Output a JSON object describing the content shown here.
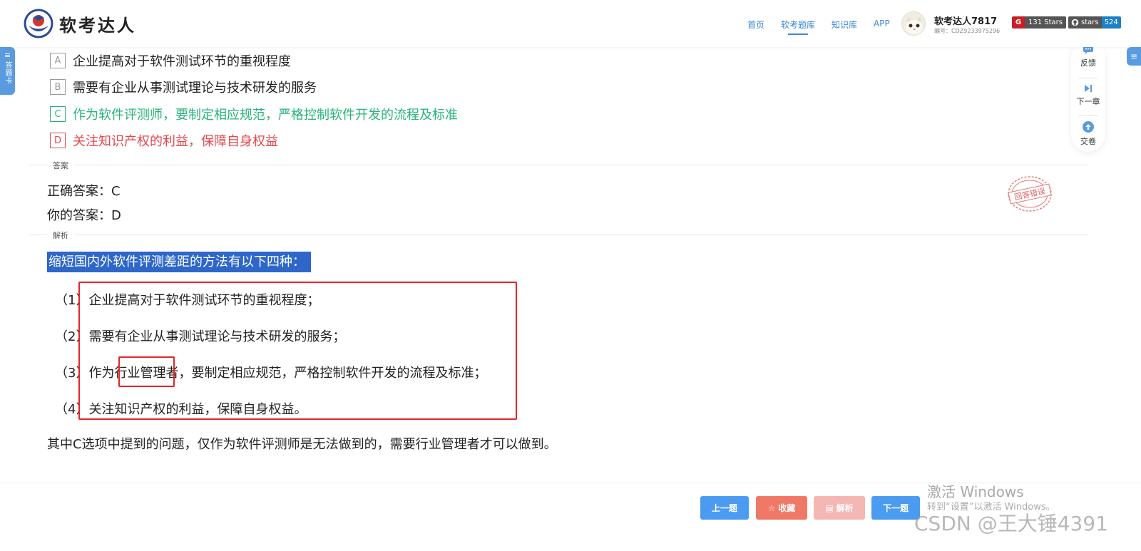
{
  "header": {
    "brand": "软考达人",
    "nav": [
      "首页",
      "软考题库",
      "知识库",
      "APP"
    ],
    "user_name": "软考达人7817",
    "user_id": "编号：CDZ9233975296",
    "badge1_icon": "gitee-icon",
    "badge1_value": "131 Stars",
    "badge2_label": "stars",
    "badge2_value": "524"
  },
  "card_tab": {
    "icon": "≡",
    "label": "答题卡"
  },
  "right_tab_icon": "≡",
  "float_panel": {
    "feedback": "反馈",
    "next_chapter": "下一章",
    "submit": "交卷"
  },
  "options": [
    {
      "letter": "A",
      "text": "企业提高对于软件测试环节的重视程度",
      "state": "normal"
    },
    {
      "letter": "B",
      "text": "需要有企业从事测试理论与技术研发的服务",
      "state": "normal"
    },
    {
      "letter": "C",
      "text": "作为软件评测师，要制定相应规范，严格控制软件开发的流程及标准",
      "state": "correct"
    },
    {
      "letter": "D",
      "text": "关注知识产权的利益，保障自身权益",
      "state": "wrong"
    }
  ],
  "answer_section": {
    "label": "答案",
    "correct": "正确答案：C",
    "yours": "你的答案：D",
    "stamp": "回答错误"
  },
  "analysis": {
    "label": "解析",
    "intro": "缩短国内外软件评测差距的方法有以下四种：",
    "points": [
      {
        "num": "（1）",
        "text": "企业提高对于软件测试环节的重视程度；"
      },
      {
        "num": "（2）",
        "text": "需要有企业从事测试理论与技术研发的服务；"
      },
      {
        "num": "（3）",
        "text": "作为行业管理者，要制定相应规范，严格控制软件开发的流程及标准；"
      },
      {
        "num": "（4）",
        "text": "关注知识产权的利益，保障自身权益。"
      }
    ],
    "summary": "其中C选项中提到的问题，仅作为软件评测师是无法做到的，需要行业管理者才可以做到。"
  },
  "buttons": {
    "prev": "上一题",
    "favorite": "收藏",
    "analysis": "解析",
    "next": "下一题"
  },
  "watermark": {
    "line1": "激活 Windows",
    "line2": "转到“设置”以激活 Windows。",
    "csdn": "CSDN @王大锤4391"
  },
  "colors": {
    "accent": "#3a86d6",
    "correct": "#27b47a",
    "wrong": "#e5484d",
    "highlight": "#2e67c9",
    "annotation_box": "#e5232b"
  }
}
